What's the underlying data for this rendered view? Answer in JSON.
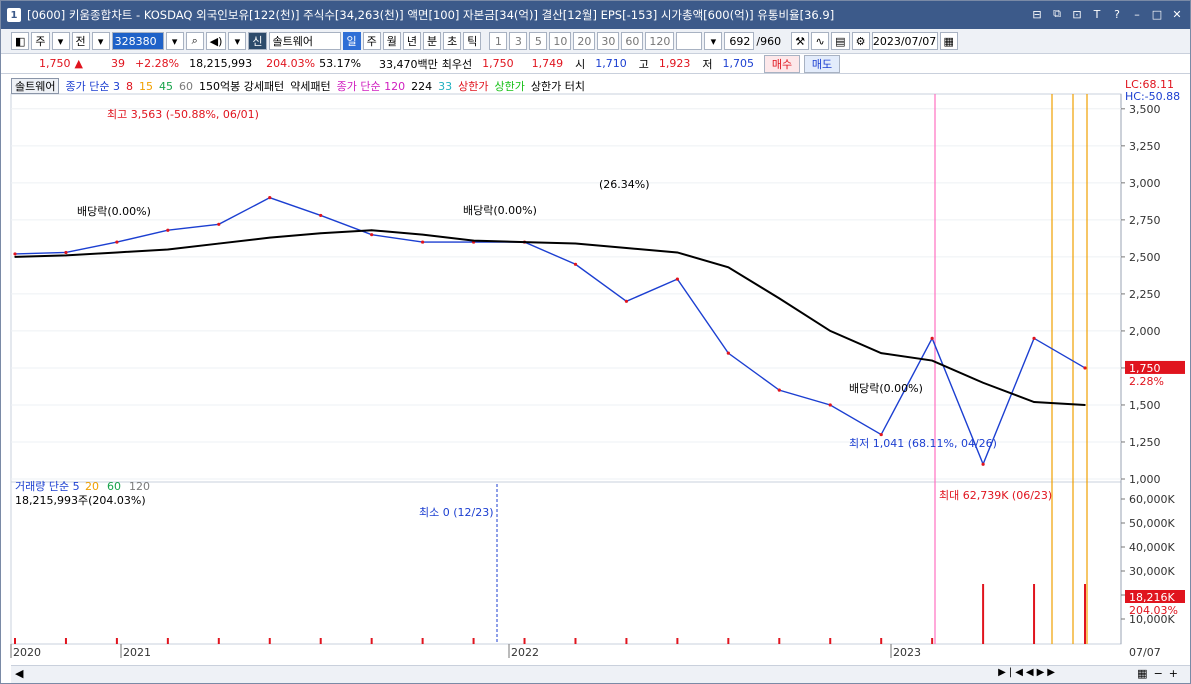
{
  "window": {
    "number": "1",
    "title": "[0600] 키움종합차트 - KOSDAQ 외국인보유[122(천)] 주식수[34,263(천)] 액면[100] 자본금[34(억)] 결산[12월] EPS[-153] 시가총액[600(억)] 유통비율[36.9]"
  },
  "toolbar": {
    "type_select": "주",
    "mode": "전",
    "stock_code": "328380",
    "stock_name": "솔트웨어",
    "new_tag": "신",
    "periods": [
      "일",
      "주",
      "월",
      "년",
      "분",
      "초",
      "틱"
    ],
    "active_period": "일",
    "intervals": [
      "1",
      "3",
      "5",
      "10",
      "20",
      "30",
      "60",
      "120"
    ],
    "count": "692",
    "total": "/960",
    "date": "2023/07/07"
  },
  "info": {
    "price": "1,750",
    "arrow": "▲",
    "change": "39",
    "change_pct": "+2.28%",
    "volume": "18,215,993",
    "vol_ratio": "204.03%",
    "turnover": "53.17%",
    "trade_value": "33,470백만",
    "bid_label": "최우선",
    "ask1": "1,750",
    "bid1": "1,749",
    "open_label": "시",
    "open": "1,710",
    "high_label": "고",
    "high": "1,923",
    "low_label": "저",
    "low": "1,705",
    "buy_button": "매수",
    "sell_button": "매도"
  },
  "price_legend": {
    "name": "솔트웨어",
    "ma_label": "종가 단순 3",
    "ma_values": [
      "8",
      "15",
      "45",
      "60"
    ],
    "ma_colors": [
      "#1c3fd1",
      "#e0141e",
      "#f0a000",
      "#17a34a",
      "#7a7a7a"
    ],
    "special": "150억봉 강세패턴",
    "weak": "약세패턴",
    "ma120_label": "종가 단순 120",
    "ma224": "224",
    "ma33": "33",
    "upper_limit": "상한가",
    "upper_limit2": "상한가",
    "upper_touch": "상한가 터치",
    "lc": "LC:68.11",
    "hc": "HC:-50.88"
  },
  "volume_legend": {
    "label": "거래량 단순 5",
    "v20": "20",
    "v60": "60",
    "v120": "120",
    "current": "18,215,993주(204.03%)"
  },
  "annotations": {
    "high": "최고 3,563 (-50.88%, 06/01)",
    "low": "최저 1,041 (68.11%, 04/26)",
    "dividend1": "배당락(0.00%)",
    "dividend2": "배당락(0.00%)",
    "dividend3": "배당락(0.00%)",
    "pct": "(26.34%)",
    "vol_min": "최소 0 (12/23)",
    "vol_max": "최대 62,739K (06/23)"
  },
  "price_axis": [
    "3,500",
    "3,250",
    "3,000",
    "2,750",
    "2,500",
    "2,250",
    "2,000",
    "1,750",
    "1,500",
    "1,250",
    "1,000"
  ],
  "price_current": "1,750",
  "price_current_pct": "2.28%",
  "volume_axis": [
    "60,000K",
    "50,000K",
    "40,000K",
    "30,000K",
    "20,000K",
    "10,000K"
  ],
  "volume_current": "18,216K",
  "volume_current_pct": "204.03%",
  "time_axis": [
    "2020",
    "2021",
    "2022",
    "2023",
    "07/07"
  ],
  "colors": {
    "title_bg": "#3c5a8a",
    "up": "#e0141e",
    "down": "#1c3fd1",
    "ma_long": "#000000",
    "ma_magenta": "#d020c0",
    "highlight_bar": "#f0a000"
  },
  "chart_data": {
    "type": "line",
    "title": "",
    "x": [
      "2020-06",
      "2020-09",
      "2020-12",
      "2021-01",
      "2021-03",
      "2021-06",
      "2021-07",
      "2021-09",
      "2021-12",
      "2022-01",
      "2022-03",
      "2022-04",
      "2022-06",
      "2022-07",
      "2022-09",
      "2022-11",
      "2023-01",
      "2023-02",
      "2023-03",
      "2023-04",
      "2023-06",
      "2023-07"
    ],
    "series": [
      {
        "name": "종가",
        "values": [
          2520,
          2530,
          2600,
          2680,
          2720,
          2900,
          2780,
          2650,
          2600,
          2600,
          2600,
          2450,
          2200,
          2350,
          1850,
          1600,
          1500,
          1300,
          1950,
          1100,
          1950,
          1750
        ]
      },
      {
        "name": "224",
        "values": [
          2500,
          2510,
          2530,
          2550,
          2590,
          2630,
          2660,
          2680,
          2650,
          2610,
          2600,
          2590,
          2560,
          2530,
          2430,
          2220,
          2000,
          1850,
          1800,
          1650,
          1520,
          1500
        ]
      }
    ],
    "ylim": [
      1000,
      3600
    ]
  }
}
